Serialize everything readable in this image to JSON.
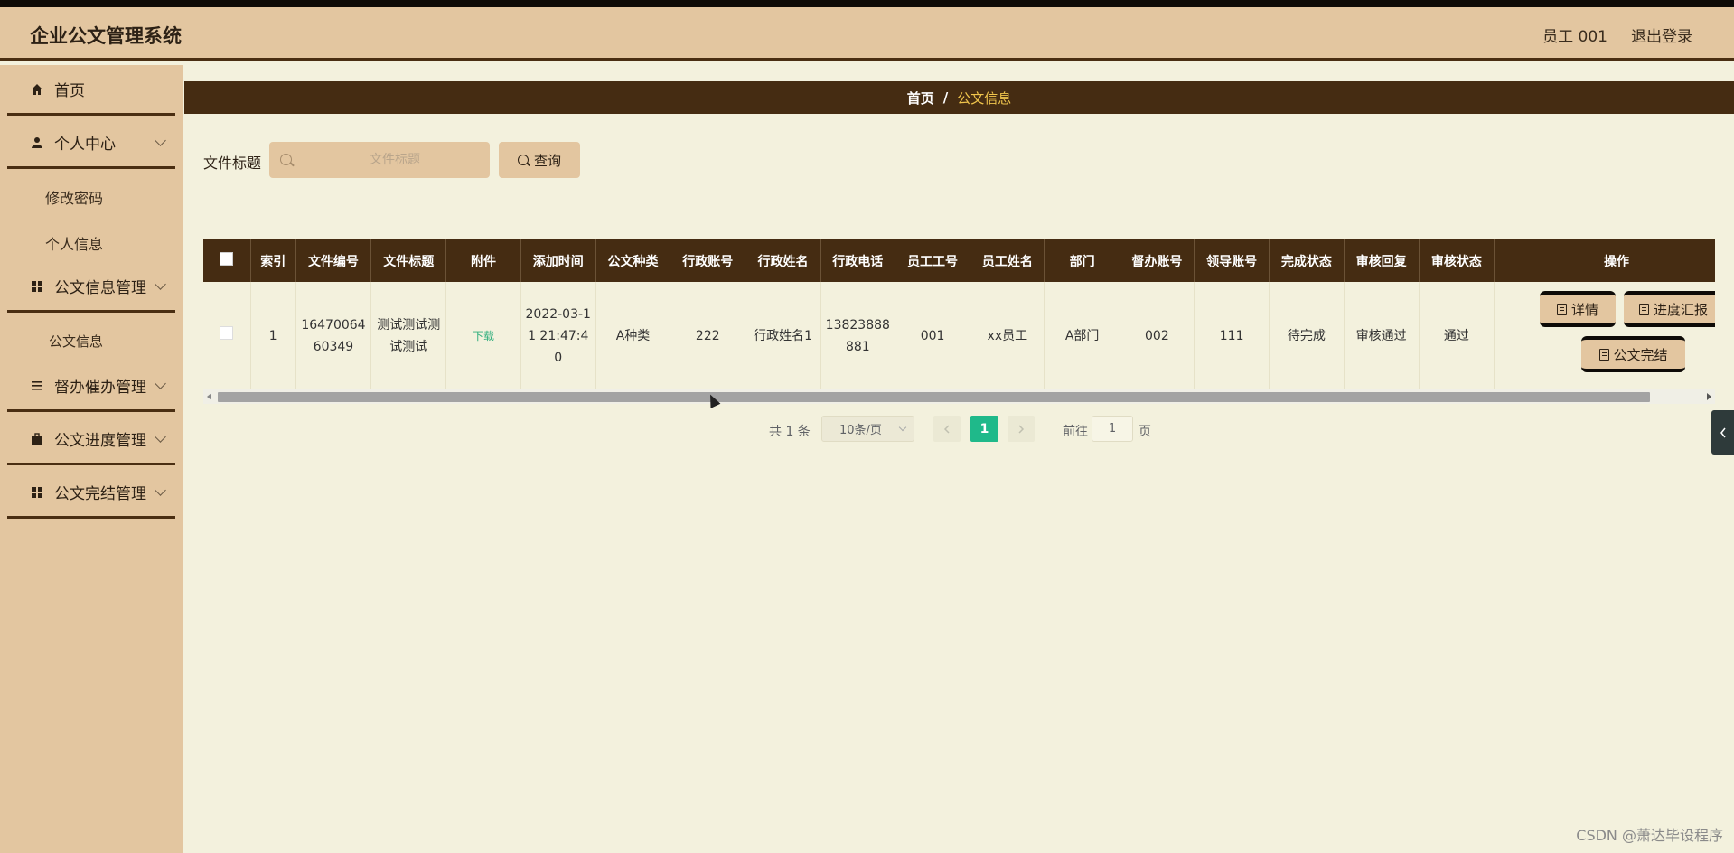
{
  "app": {
    "title": "企业公文管理系统"
  },
  "header": {
    "user": "员工 001",
    "logout": "退出登录"
  },
  "sidebar": {
    "items": [
      {
        "label": "首页",
        "icon": "home-icon"
      },
      {
        "label": "个人中心",
        "icon": "user-icon",
        "sub": [
          "修改密码",
          "个人信息"
        ]
      },
      {
        "label": "公文信息管理",
        "icon": "grid-icon",
        "sub": [
          "公文信息"
        ]
      },
      {
        "label": "督办催办管理",
        "icon": "list-icon"
      },
      {
        "label": "公文进度管理",
        "icon": "briefcase-icon"
      },
      {
        "label": "公文完结管理",
        "icon": "grid-icon"
      }
    ]
  },
  "breadcrumb": {
    "home": "首页",
    "sep": "/",
    "current": "公文信息"
  },
  "search": {
    "label": "文件标题",
    "placeholder": "文件标题",
    "button": "查询"
  },
  "table": {
    "columns": [
      "索引",
      "文件编号",
      "文件标题",
      "附件",
      "添加时间",
      "公文种类",
      "行政账号",
      "行政姓名",
      "行政电话",
      "员工工号",
      "员工姓名",
      "部门",
      "督办账号",
      "领导账号",
      "完成状态",
      "审核回复",
      "审核状态",
      "操作"
    ],
    "rows": [
      {
        "index": "1",
        "file_no": "1647006460349",
        "title": "测试测试测试测试",
        "attachment": "下载",
        "added": "2022-03-11 21:47:40",
        "category": "A种类",
        "admin_account": "222",
        "admin_name": "行政姓名1",
        "admin_phone": "13823888881",
        "staff_no": "001",
        "staff_name": "xx员工",
        "dept": "A部门",
        "supervisor": "002",
        "leader": "111",
        "done_status": "待完成",
        "review_reply": "审核通过",
        "review_status": "通过",
        "actions": [
          "详情",
          "进度汇报",
          "公文完结"
        ]
      }
    ]
  },
  "pagination": {
    "total": "共 1 条",
    "page_size": "10条/页",
    "current_page": "1",
    "goto_label": "前往",
    "goto_value": "1",
    "goto_unit": "页"
  },
  "watermark": "CSDN @萧达毕设程序"
}
